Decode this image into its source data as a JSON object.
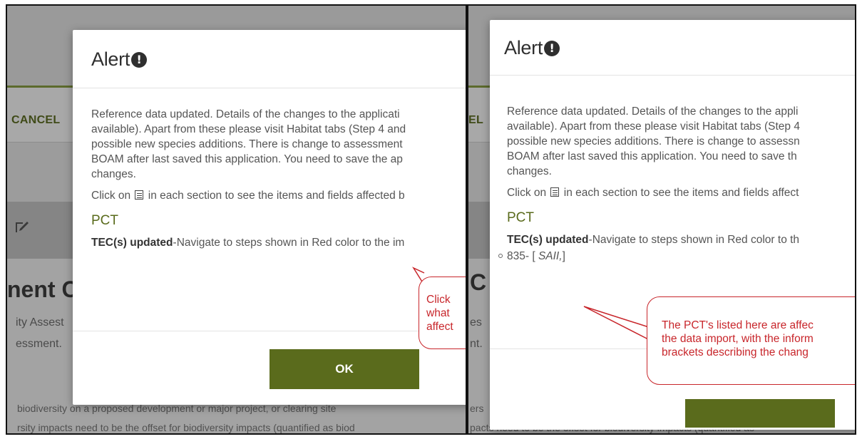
{
  "left": {
    "background": {
      "cancel_label": "CANCEL",
      "heading": "nent C",
      "sub_lines": [
        "ity Assest",
        "essment."
      ],
      "footer_lines": [
        "biodiversity on a proposed development or major project, or clearing site",
        "rsity impacts need to be the offset for biodiversity impacts (quantified as biod"
      ]
    },
    "modal": {
      "title": "Alert",
      "alert_icon": "!",
      "paragraphs": [
        "Reference data updated. Details of the changes to the applicati",
        "available). Apart from these please visit Habitat tabs (Step 4 and",
        "possible new species additions. There is change to assessment",
        "BOAM after last saved this application. You need to save the ap",
        "changes."
      ],
      "click_prefix": "Click on",
      "click_suffix": "in each section to see the items and fields affected b",
      "pct_heading": "PCT",
      "tec_bold": "TEC(s) updated",
      "tec_rest": "-Navigate to steps shown in Red color to the im",
      "ok_label": "OK"
    },
    "callout_lines": [
      "Click",
      "what",
      "affect"
    ]
  },
  "right": {
    "background": {
      "cancel_label": "EL",
      "heading": "C",
      "sub_lines": [
        "es",
        "nt."
      ],
      "footer_lines": [
        "ers",
        "pacts need to be the offset for biodiversity impacts (quantified as"
      ]
    },
    "modal": {
      "title": "Alert",
      "alert_icon": "!",
      "paragraphs": [
        "Reference data updated. Details of the changes to the appli",
        "available). Apart from these please visit Habitat tabs (Step 4",
        "possible new species additions. There is change to assessn",
        "BOAM after last saved this application. You need to save th",
        "changes."
      ],
      "click_prefix": "Click on",
      "click_suffix": "in each section to see the items and fields affect",
      "pct_heading": "PCT",
      "tec_bold": "TEC(s) updated",
      "tec_rest": "-Navigate to steps shown in Red color to th",
      "pct_item_prefix": "835- [",
      "pct_item_italic": "SAII,",
      "pct_item_suffix": "]"
    },
    "callout_lines": [
      "The PCT's listed here are affec",
      "the data import, with the inform",
      "brackets describing the chang"
    ]
  },
  "colors": {
    "accent_green": "#5a6b1c",
    "callout_red": "#c8262b"
  }
}
